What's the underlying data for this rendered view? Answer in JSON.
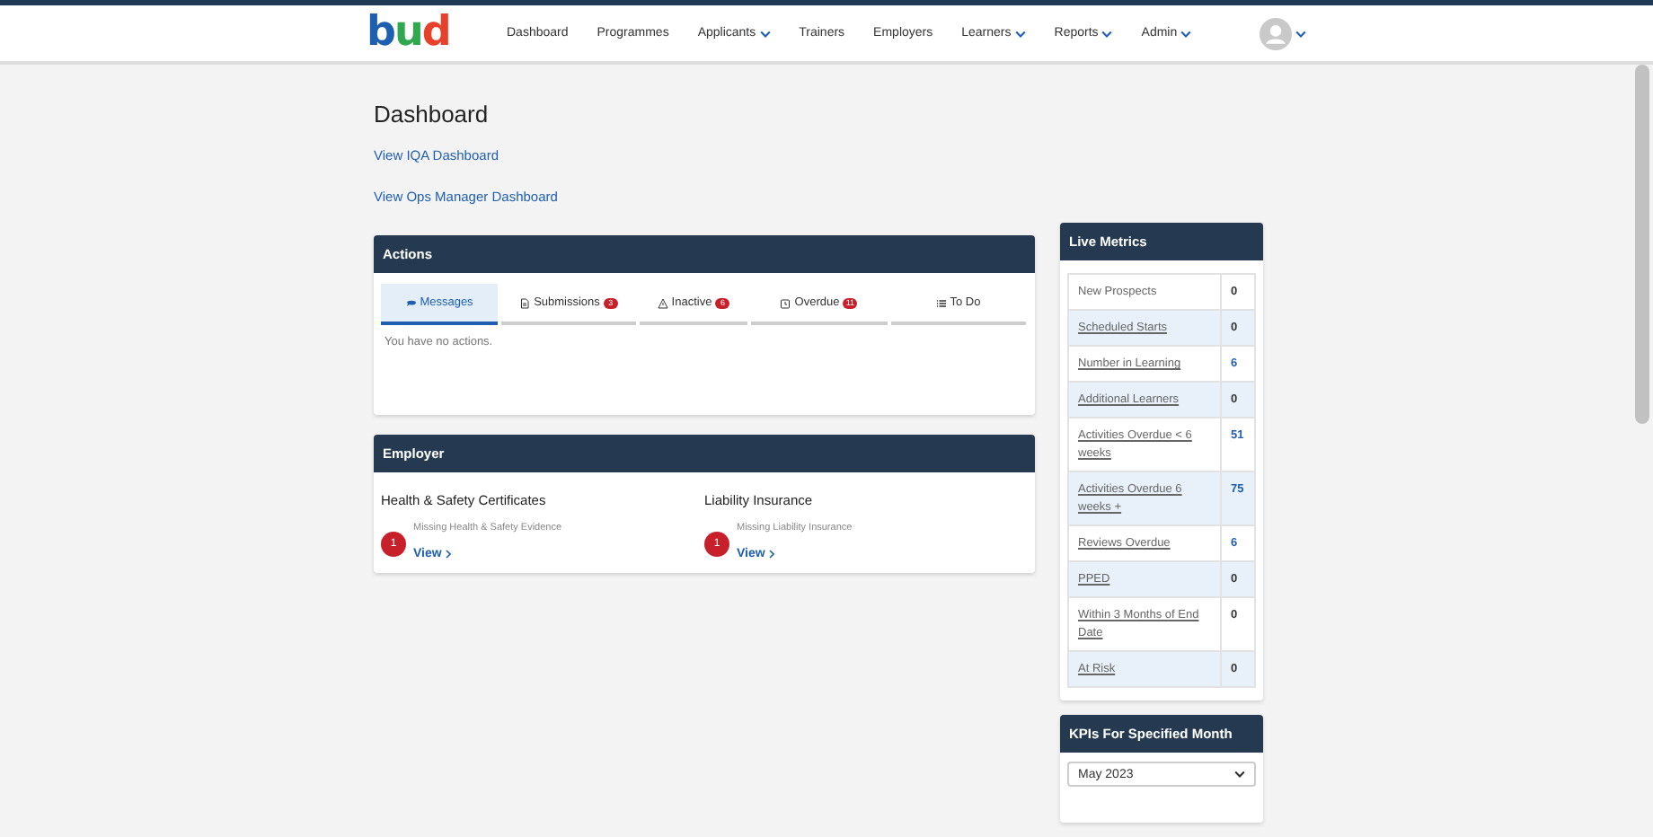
{
  "brand": "bud",
  "nav": [
    {
      "label": "Dashboard",
      "dropdown": false
    },
    {
      "label": "Programmes",
      "dropdown": false
    },
    {
      "label": "Applicants",
      "dropdown": true
    },
    {
      "label": "Trainers",
      "dropdown": false
    },
    {
      "label": "Employers",
      "dropdown": false
    },
    {
      "label": "Learners",
      "dropdown": true
    },
    {
      "label": "Reports",
      "dropdown": true
    },
    {
      "label": "Admin",
      "dropdown": true
    }
  ],
  "page_title": "Dashboard",
  "links": [
    "View IQA Dashboard",
    "View Ops Manager Dashboard"
  ],
  "actions": {
    "title": "Actions",
    "tabs": [
      {
        "label": "Messages",
        "kind": "chat",
        "selected": true
      },
      {
        "label": "Submissions",
        "kind": "file",
        "badge": "3",
        "selected": false
      },
      {
        "label": "Inactive",
        "kind": "warning",
        "badge": "6",
        "selected": false
      },
      {
        "label": "Overdue",
        "kind": "clock",
        "badge": "11",
        "selected": false
      },
      {
        "label": "To Do",
        "kind": "list",
        "selected": false
      }
    ],
    "empty_text": "You have no actions."
  },
  "employer": {
    "title": "Employer",
    "sections": [
      {
        "heading": "Health & Safety Certificates",
        "count": "1",
        "text": "Missing Health & Safety Evidence",
        "link": "View"
      },
      {
        "heading": "Liability Insurance",
        "count": "1",
        "text": "Missing Liability Insurance",
        "link": "View"
      }
    ]
  },
  "live_metrics": {
    "title": "Live Metrics",
    "rows": [
      {
        "label": "New Prospects",
        "value": "0",
        "link": false,
        "value_link": false
      },
      {
        "label": "Scheduled Starts",
        "value": "0",
        "link": true,
        "value_link": false
      },
      {
        "label": "Number in Learning",
        "value": "6",
        "link": true,
        "value_link": true
      },
      {
        "label": "Additional Learners",
        "value": "0",
        "link": true,
        "value_link": false
      },
      {
        "label": "Activities Overdue < 6 weeks",
        "value": "51",
        "link": true,
        "value_link": true
      },
      {
        "label": "Activities Overdue 6 weeks +",
        "value": "75",
        "link": true,
        "value_link": true
      },
      {
        "label": "Reviews Overdue",
        "value": "6",
        "link": true,
        "value_link": true
      },
      {
        "label": "PPED",
        "value": "0",
        "link": true,
        "value_link": false
      },
      {
        "label": "Within 3 Months of End Date",
        "value": "0",
        "link": true,
        "value_link": false
      },
      {
        "label": "At Risk",
        "value": "0",
        "link": true,
        "value_link": false
      }
    ]
  },
  "kpis": {
    "title": "KPIs For Specified Month",
    "month": "May 2023"
  }
}
